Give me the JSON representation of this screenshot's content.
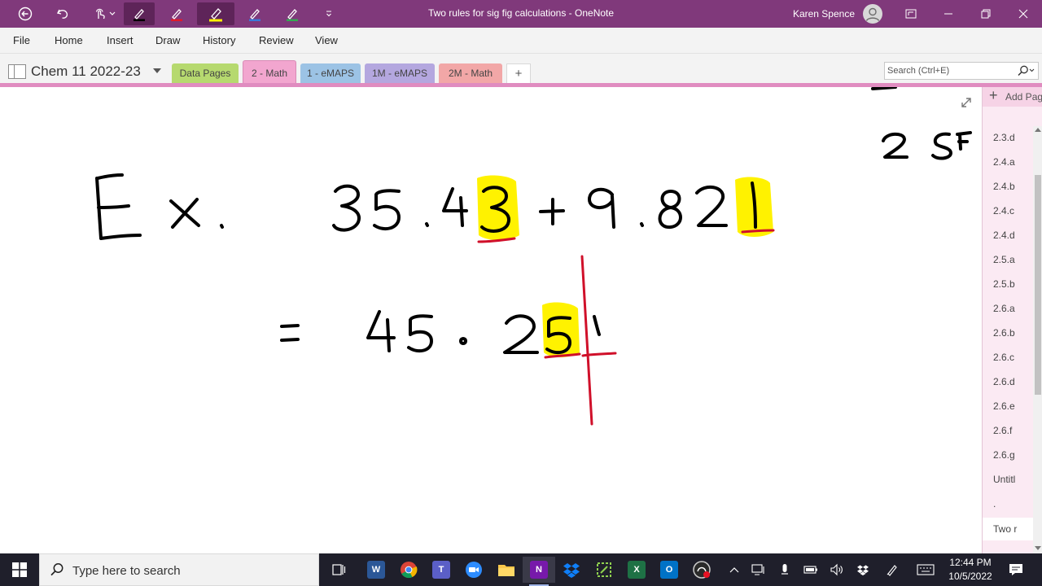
{
  "titlebar": {
    "title": "Two rules for sig fig calculations  -  OneNote",
    "user": "Karen Spence"
  },
  "menu": {
    "items": [
      "File",
      "Home",
      "Insert",
      "Draw",
      "History",
      "Review",
      "View"
    ]
  },
  "notebook": {
    "name": "Chem 11 2022-23"
  },
  "sections": [
    {
      "label": "Data Pages",
      "color": "#b6d96f"
    },
    {
      "label": "2 - Math",
      "color": "#f2a6cf"
    },
    {
      "label": "1 - eMAPS",
      "color": "#9cc3e5"
    },
    {
      "label": "1M - eMAPS",
      "color": "#b4a7df"
    },
    {
      "label": "2M - Math",
      "color": "#f2a7a7"
    }
  ],
  "search": {
    "placeholder": "Search (Ctrl+E)"
  },
  "pages": {
    "add_label": "Add Page",
    "items": [
      "2.3.d",
      "2.4.a",
      "2.4.b",
      "2.4.c",
      "2.4.d",
      "2.5.a",
      "2.5.b",
      "2.6.a",
      "2.6.b",
      "2.6.c",
      "2.6.d",
      "2.6.e",
      "2.6.f",
      "2.6.g",
      "Untitl",
      ".",
      "Two r"
    ]
  },
  "taskbar": {
    "search_placeholder": "Type here to search",
    "time": "12:44 PM",
    "date": "10/5/2022"
  },
  "colors": {
    "titlebar": "#80397b",
    "active_section": "#f2a6cf",
    "highlight": "#fff200",
    "red_ink": "#d0102a"
  },
  "icons": [
    "back-icon",
    "undo-icon",
    "touch-icon",
    "pen-icon",
    "highlighter-icon",
    "restore-icon",
    "minimize-icon",
    "maximize-icon",
    "close-icon",
    "search-icon",
    "windows-icon",
    "task-view-icon"
  ]
}
